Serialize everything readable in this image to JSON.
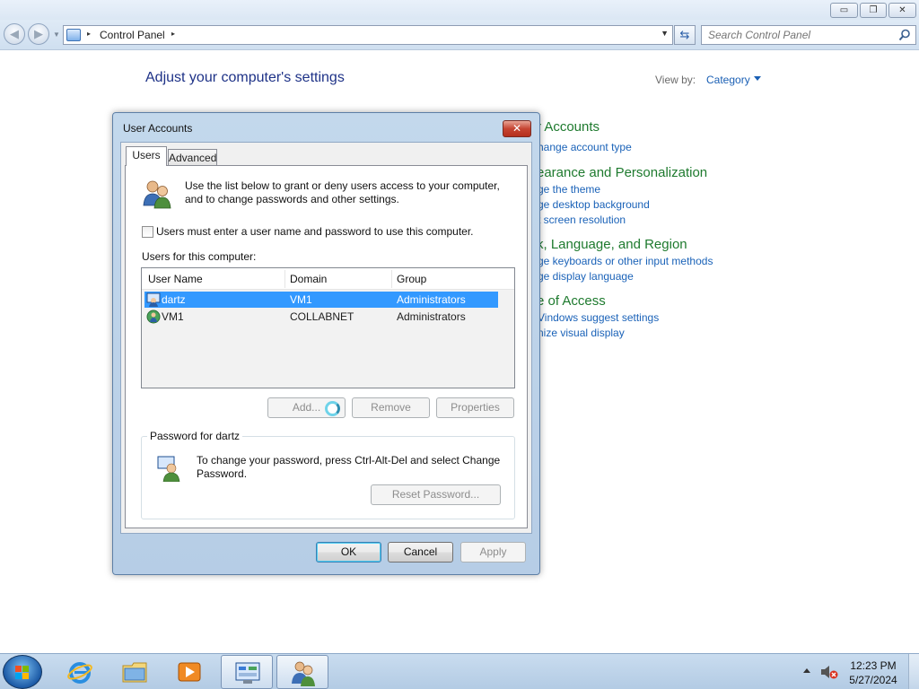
{
  "window": {
    "caption_buttons": {
      "minimize": "▭",
      "restore": "❐",
      "close": "✕"
    },
    "address_bar": {
      "path_root": "Control Panel",
      "separator": "▸"
    },
    "search": {
      "placeholder": "Search Control Panel"
    }
  },
  "control_panel": {
    "heading": "Adjust your computer's settings",
    "view_by_label": "View by:",
    "view_by_value": "Category",
    "categories": [
      {
        "title": "r Accounts",
        "links": [
          "hange account type"
        ]
      },
      {
        "title": "earance and Personalization",
        "links": [
          "ge the theme",
          "ge desktop background",
          "t screen resolution"
        ]
      },
      {
        "title": "k, Language, and Region",
        "links": [
          "ge keyboards or other input methods",
          "ge display language"
        ]
      },
      {
        "title": "e of Access",
        "links": [
          "Vindows suggest settings",
          "nize visual display"
        ]
      }
    ]
  },
  "dialog": {
    "title": "User Accounts",
    "close_glyph": "✕",
    "tabs": [
      "Users",
      "Advanced"
    ],
    "intro": "Use the list below to grant or deny users access to your computer, and to change passwords and other settings.",
    "checkbox_label": "Users must enter a user name and password to use this computer.",
    "checkbox_checked": false,
    "users_label": "Users for this computer:",
    "columns": [
      "User Name",
      "Domain",
      "Group"
    ],
    "users": [
      {
        "name": "dartz",
        "domain": "VM1",
        "group": "Administrators",
        "selected": true
      },
      {
        "name": "VM1",
        "domain": "COLLABNET",
        "group": "Administrators",
        "selected": false
      }
    ],
    "buttons": {
      "add": "Add...",
      "remove": "Remove",
      "properties": "Properties"
    },
    "password_group": {
      "legend": "Password for dartz",
      "text": "To change your password, press Ctrl-Alt-Del and select Change Password.",
      "reset_button": "Reset Password..."
    },
    "footer": {
      "ok": "OK",
      "cancel": "Cancel",
      "apply": "Apply"
    }
  },
  "taskbar": {
    "clock_time": "12:23 PM",
    "clock_date": "5/27/2024"
  },
  "colors": {
    "selection": "#3399ff",
    "link": "#1a62b8",
    "category_title": "#1e7a2e",
    "heading": "#1e3287"
  }
}
